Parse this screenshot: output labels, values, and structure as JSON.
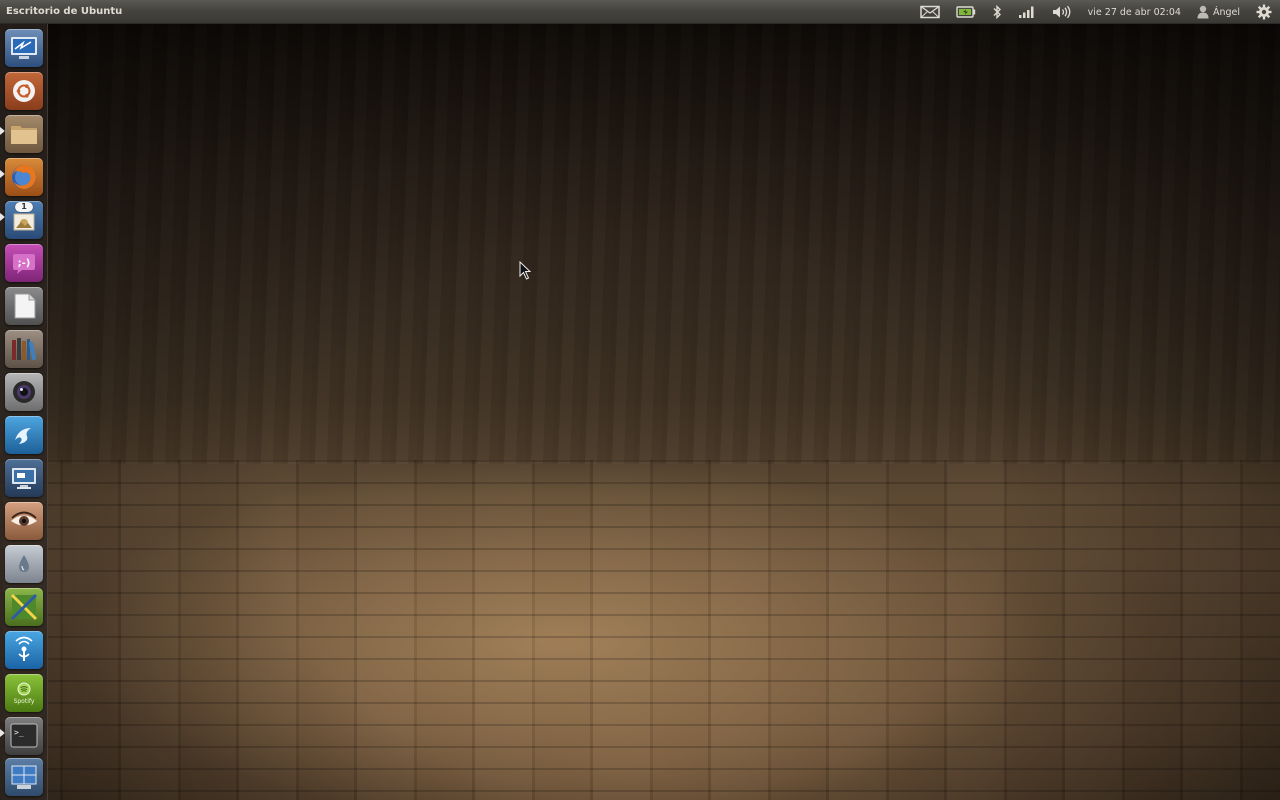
{
  "panel": {
    "title": "Escritorio de Ubuntu",
    "indicators": {
      "mail": "mail-icon",
      "battery": "battery-icon",
      "bluetooth": "bluetooth-icon",
      "network": "network-signal-icon",
      "sound": "volume-icon",
      "clock": "vie 27 de abr 02:04",
      "user": "Ángel",
      "session": "gear-icon"
    }
  },
  "launcher": {
    "items": [
      {
        "name": "remote-desktop",
        "icon": "remote-desktop-icon",
        "running": false
      },
      {
        "name": "ubuntu-software",
        "icon": "ubuntu-logo-icon",
        "running": false
      },
      {
        "name": "files",
        "icon": "folder-icon",
        "running": true
      },
      {
        "name": "firefox",
        "icon": "firefox-icon",
        "running": true
      },
      {
        "name": "mail-client",
        "icon": "mail-stamp-icon",
        "running": true,
        "badge": "1"
      },
      {
        "name": "empathy",
        "icon": "chat-smiley-icon",
        "running": false,
        "label": ";-)"
      },
      {
        "name": "text-editor",
        "icon": "document-icon",
        "running": false
      },
      {
        "name": "library",
        "icon": "books-icon",
        "running": false
      },
      {
        "name": "webcam",
        "icon": "camera-lens-icon",
        "running": false
      },
      {
        "name": "app-blue",
        "icon": "blue-swirl-icon",
        "running": false
      },
      {
        "name": "display",
        "icon": "monitor-icon",
        "running": false
      },
      {
        "name": "eye-app",
        "icon": "eye-icon",
        "running": false
      },
      {
        "name": "droplet-app",
        "icon": "droplet-icon",
        "running": false
      },
      {
        "name": "map-tool",
        "icon": "map-ruler-icon",
        "running": false
      },
      {
        "name": "wireless",
        "icon": "wifi-antenna-icon",
        "running": false
      },
      {
        "name": "spotify",
        "icon": "spotify-icon",
        "running": false,
        "label": "Spotify"
      },
      {
        "name": "terminal",
        "icon": "terminal-icon",
        "running": true,
        "label": ">_"
      },
      {
        "name": "workspaces",
        "icon": "workspace-switcher-icon",
        "running": false
      }
    ]
  },
  "colors": {
    "panel": "#45443f",
    "panel_text": "#dfdbd2",
    "launcher_bg": "#2d2621"
  }
}
